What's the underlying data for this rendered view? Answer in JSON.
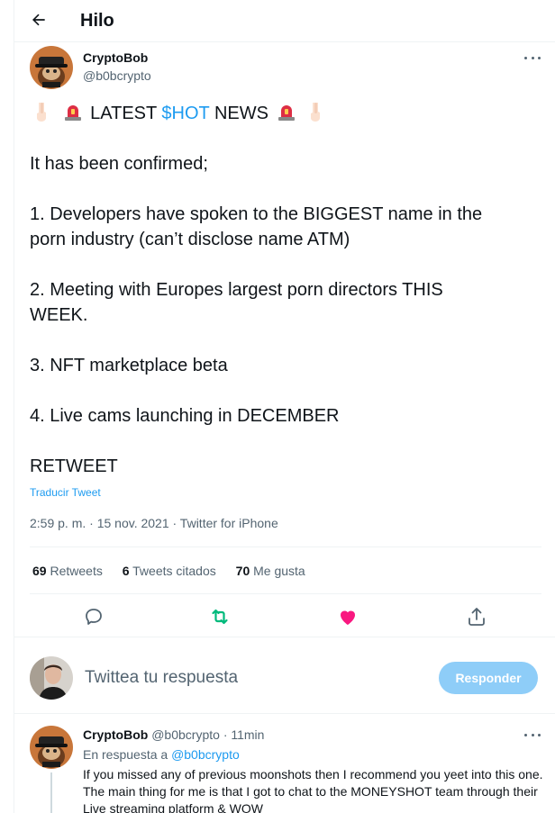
{
  "header": {
    "title": "Hilo"
  },
  "tweet": {
    "author_name": "CryptoBob",
    "author_handle": "@b0bcrypto",
    "line1_before": "LATEST ",
    "line1_cashtag": "$HOT",
    "line1_after": " NEWS",
    "lines": [
      "It has been confirmed;",
      "",
      "1. Developers have spoken to the BIGGEST name in the",
      "porn industry (can’t disclose name ATM)",
      "",
      "2. Meeting with Europes largest porn directors THIS",
      "WEEK.",
      "",
      "3. NFT marketplace beta",
      "",
      "4. Live cams launching in DECEMBER",
      "",
      "RETWEET"
    ],
    "translate_label": "Traducir Tweet",
    "timestamp": "2:59 p. m. · 15 nov. 2021 · Twitter for iPhone",
    "retweets_count": "69",
    "retweets_label": "Retweets",
    "quotes_count": "6",
    "quotes_label": "Tweets citados",
    "likes_count": "70",
    "likes_label": "Me gusta"
  },
  "compose": {
    "placeholder": "Twittea tu respuesta",
    "reply_button": "Responder"
  },
  "reply": {
    "author_name": "CryptoBob",
    "author_handle": "@b0bcrypto",
    "time": "· 11min",
    "in_reply_prefix": "En respuesta a ",
    "in_reply_handle": "@b0bcrypto",
    "text": "If you missed any of previous moonshots then I recommend you yeet into this one. The main thing for me is that I got to chat to the MONEYSHOT team through their Live streaming platform & WOW"
  },
  "icons": {
    "back": "arrow-left-icon",
    "more": "more-dots-icon",
    "reply": "speech-bubble-icon",
    "retweet": "retweet-icon",
    "like": "heart-icon",
    "share": "share-icon",
    "emoji_point": "backhand-index-pointing-down-emoji",
    "emoji_siren": "police-light-emoji"
  },
  "colors": {
    "accent": "#1d9bf0",
    "retweet_active": "#00ba7c",
    "like_active": "#f91880",
    "muted": "#536471"
  }
}
